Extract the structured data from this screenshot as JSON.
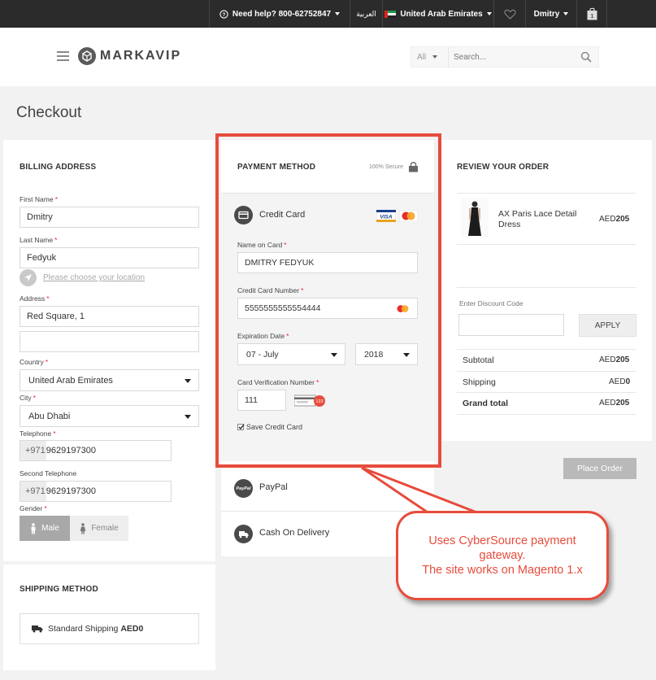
{
  "topbar": {
    "help": "Need help? 800-62752847",
    "language": "العربية",
    "country": "United Arab Emirates",
    "user": "Dmitry",
    "icons": [
      "help-circle-icon",
      "heart-icon",
      "shopping-bag-icon"
    ]
  },
  "header": {
    "logo": "MARKAVIP",
    "search_category": "All",
    "search_placeholder": "Search..."
  },
  "page_title": "Checkout",
  "billing": {
    "title": "BILLING ADDRESS",
    "first_name_label": "First Name",
    "first_name": "Dmitry",
    "last_name_label": "Last Name",
    "last_name": "Fedyuk",
    "location_link": "Please choose your location",
    "address_label": "Address",
    "address_line1": "Red Square, 1",
    "address_line2": "",
    "country_label": "Country",
    "country": "United Arab Emirates",
    "city_label": "City",
    "city": "Abu Dhabi",
    "telephone_label": "Telephone",
    "telephone_prefix": "+971",
    "telephone": "9629197300",
    "second_telephone_label": "Second Telephone",
    "second_telephone_prefix": "+971",
    "second_telephone": "9629197300",
    "gender_label": "Gender",
    "gender_male": "Male",
    "gender_female": "Female"
  },
  "shipping": {
    "title": "SHIPPING METHOD",
    "method": "Standard Shipping",
    "price": "AED0"
  },
  "payment": {
    "title": "PAYMENT METHOD",
    "secure_label": "100% Secure",
    "credit_card_label": "Credit Card",
    "name_on_card_label": "Name on Card",
    "name_on_card": "DMITRY FEDYUK",
    "card_number_label": "Credit Card Number",
    "card_number": "5555555555554444",
    "expiration_label": "Expiration Date",
    "exp_month": "07 - July",
    "exp_year": "2018",
    "cvv_label": "Card Verification Number",
    "cvv": "111",
    "cvv_badge": "123",
    "save_card_label": "Save Credit Card",
    "paypal_label": "PayPal",
    "paypal_badge": "PayPal",
    "cod_label": "Cash On Delivery"
  },
  "review": {
    "title": "REVIEW YOUR ORDER",
    "item_name": "AX Paris Lace Detail Dress",
    "item_currency": "AED",
    "item_price": "205",
    "discount_label": "Enter Discount Code",
    "apply_label": "APPLY",
    "subtotal_label": "Subtotal",
    "subtotal_currency": "AED",
    "subtotal_value": "205",
    "shipping_label": "Shipping",
    "shipping_currency": "AED",
    "shipping_value": "0",
    "total_label": "Grand total",
    "total_currency": "AED",
    "total_value": "205",
    "place_order_label": "Place Order"
  },
  "annotation": {
    "line1": "Uses CyberSource payment",
    "line2": "gateway.",
    "line3": "The site works on Magento 1.x"
  },
  "colors": {
    "highlight": "#e74c3c",
    "topbar": "#2b2b2b",
    "required": "#e23"
  }
}
